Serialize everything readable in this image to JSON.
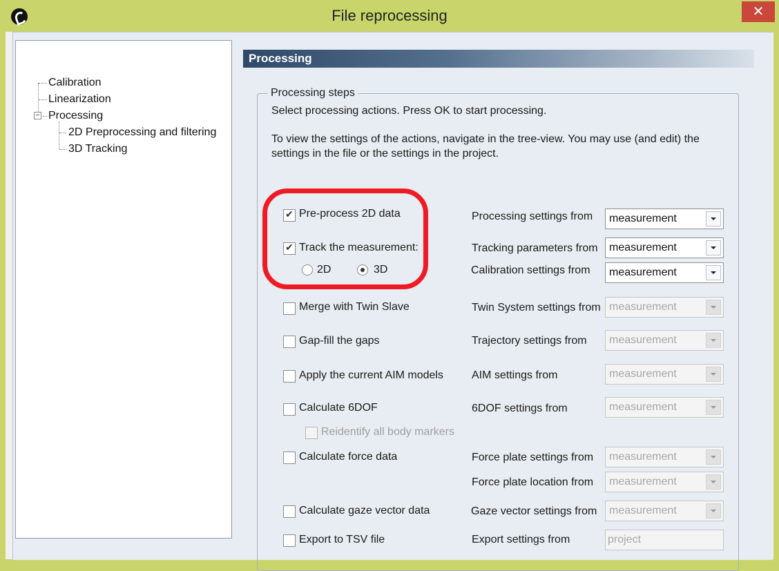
{
  "window": {
    "title": "File reprocessing",
    "close_glyph": "✕"
  },
  "tree": {
    "items": [
      {
        "label": "Calibration"
      },
      {
        "label": "Linearization"
      },
      {
        "label": "Processing"
      },
      {
        "label": "2D Preprocessing and filtering"
      },
      {
        "label": "3D Tracking"
      }
    ],
    "expander_glyph": "−"
  },
  "panel": {
    "header": "Processing"
  },
  "group": {
    "legend": "Processing steps",
    "line1": "Select processing actions. Press OK to start processing.",
    "line2": "To view the settings of the actions, navigate in the tree-view. You may use (and edit) the settings in the file or the settings in the project."
  },
  "steps": {
    "preprocess": {
      "label": "Pre-process 2D data",
      "checked": true
    },
    "track": {
      "label": "Track the measurement:",
      "checked": true
    },
    "radio_2d": "2D",
    "radio_3d": "3D",
    "merge": {
      "label": "Merge with Twin Slave",
      "checked": false
    },
    "gapfill": {
      "label": "Gap-fill the gaps",
      "checked": false
    },
    "aim": {
      "label": "Apply the current AIM models",
      "checked": false
    },
    "sixdof": {
      "label": "Calculate 6DOF",
      "checked": false
    },
    "reidentify": {
      "label": "Reidentify all body markers",
      "checked": false
    },
    "force": {
      "label": "Calculate force data",
      "checked": false
    },
    "gaze": {
      "label": "Calculate gaze vector data",
      "checked": false
    },
    "tsv": {
      "label": "Export to TSV file",
      "checked": false
    }
  },
  "settings": {
    "processing": {
      "label": "Processing settings from",
      "value": "measurement"
    },
    "tracking": {
      "label": "Tracking parameters from",
      "value": "measurement"
    },
    "calibration": {
      "label": "Calibration settings from",
      "value": "measurement"
    },
    "twin": {
      "label": "Twin System settings from",
      "value": "measurement"
    },
    "trajectory": {
      "label": "Trajectory settings from",
      "value": "measurement"
    },
    "aim": {
      "label": "AIM settings from",
      "value": "measurement"
    },
    "sixdof": {
      "label": "6DOF settings from",
      "value": "measurement"
    },
    "forceplate": {
      "label": "Force plate settings from",
      "value": "measurement"
    },
    "forceloc": {
      "label": "Force plate location from",
      "value": "measurement"
    },
    "gaze": {
      "label": "Gaze vector settings from",
      "value": "measurement"
    },
    "export": {
      "label": "Export settings from",
      "value": "project"
    }
  },
  "colors": {
    "highlight_ring": "#ee1b24",
    "header_dark": "#2f4a68"
  }
}
